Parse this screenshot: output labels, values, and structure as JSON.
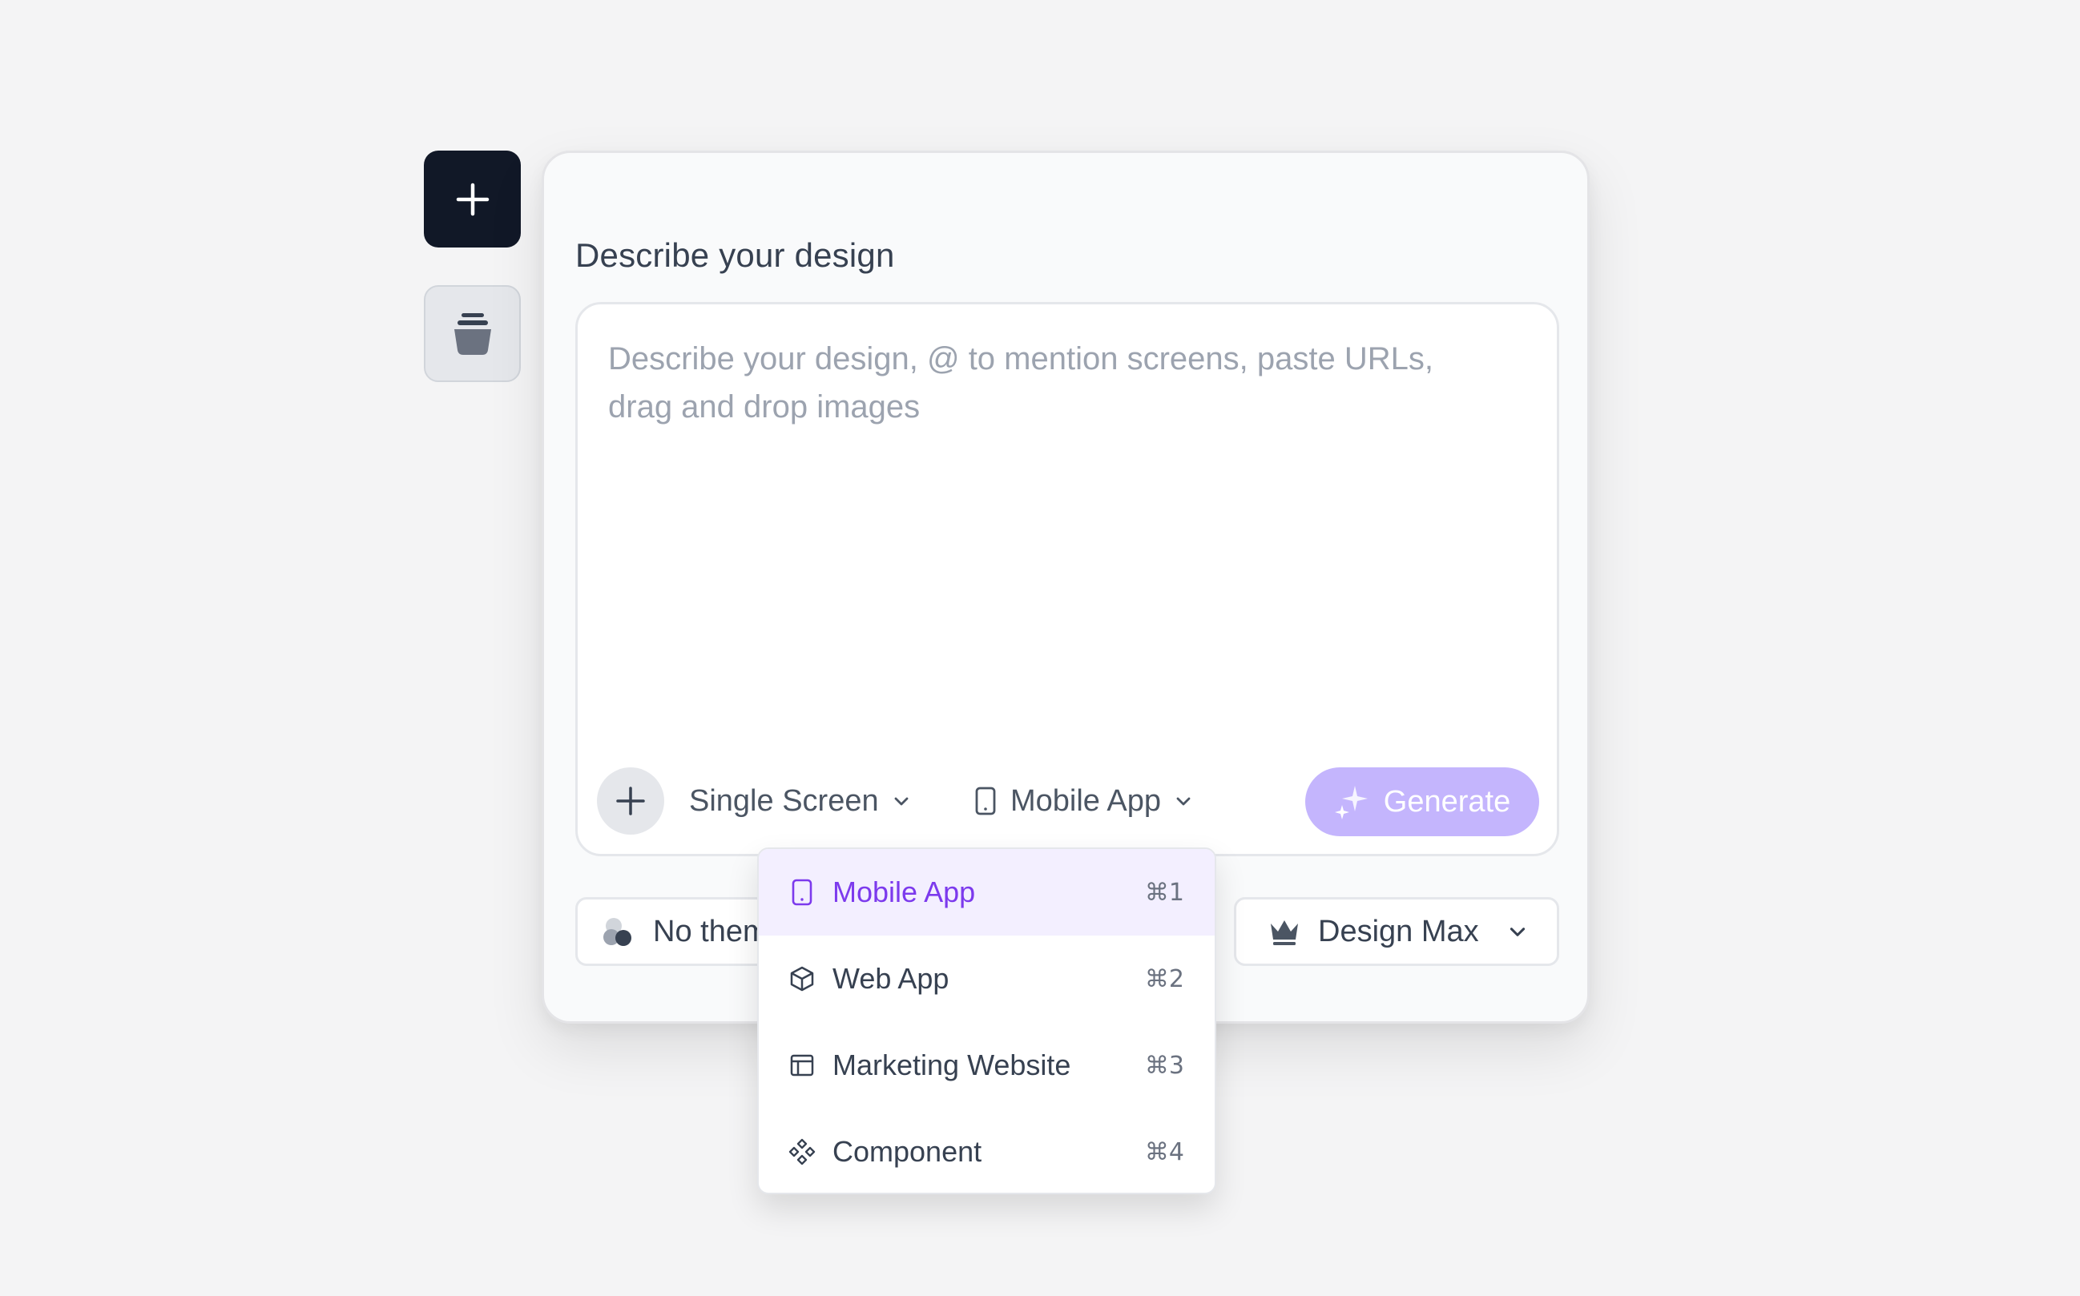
{
  "sidebar": {
    "new_icon": "plus-icon",
    "library_icon": "stack-icon"
  },
  "card": {
    "title": "Describe your design"
  },
  "prompt": {
    "placeholder": "Describe your design, @ to mention screens, paste URLs, drag and drop images",
    "value": ""
  },
  "toolbar": {
    "screens_label": "Single Screen",
    "platform_label": "Mobile App",
    "generate_label": "Generate"
  },
  "bottom": {
    "theme_label": "No theme",
    "model_label": "Design Max"
  },
  "dropdown": {
    "items": [
      {
        "label": "Mobile App",
        "shortcut": "⌘1",
        "icon": "phone-icon",
        "selected": true
      },
      {
        "label": "Web App",
        "shortcut": "⌘2",
        "icon": "cube-icon",
        "selected": false
      },
      {
        "label": "Marketing Website",
        "shortcut": "⌘3",
        "icon": "layout-icon",
        "selected": false
      },
      {
        "label": "Component",
        "shortcut": "⌘4",
        "icon": "component-icon",
        "selected": false
      }
    ]
  },
  "colors": {
    "accent": "#7c3aed",
    "generate_bg": "#c4b5fd",
    "primary_button": "#111827"
  }
}
